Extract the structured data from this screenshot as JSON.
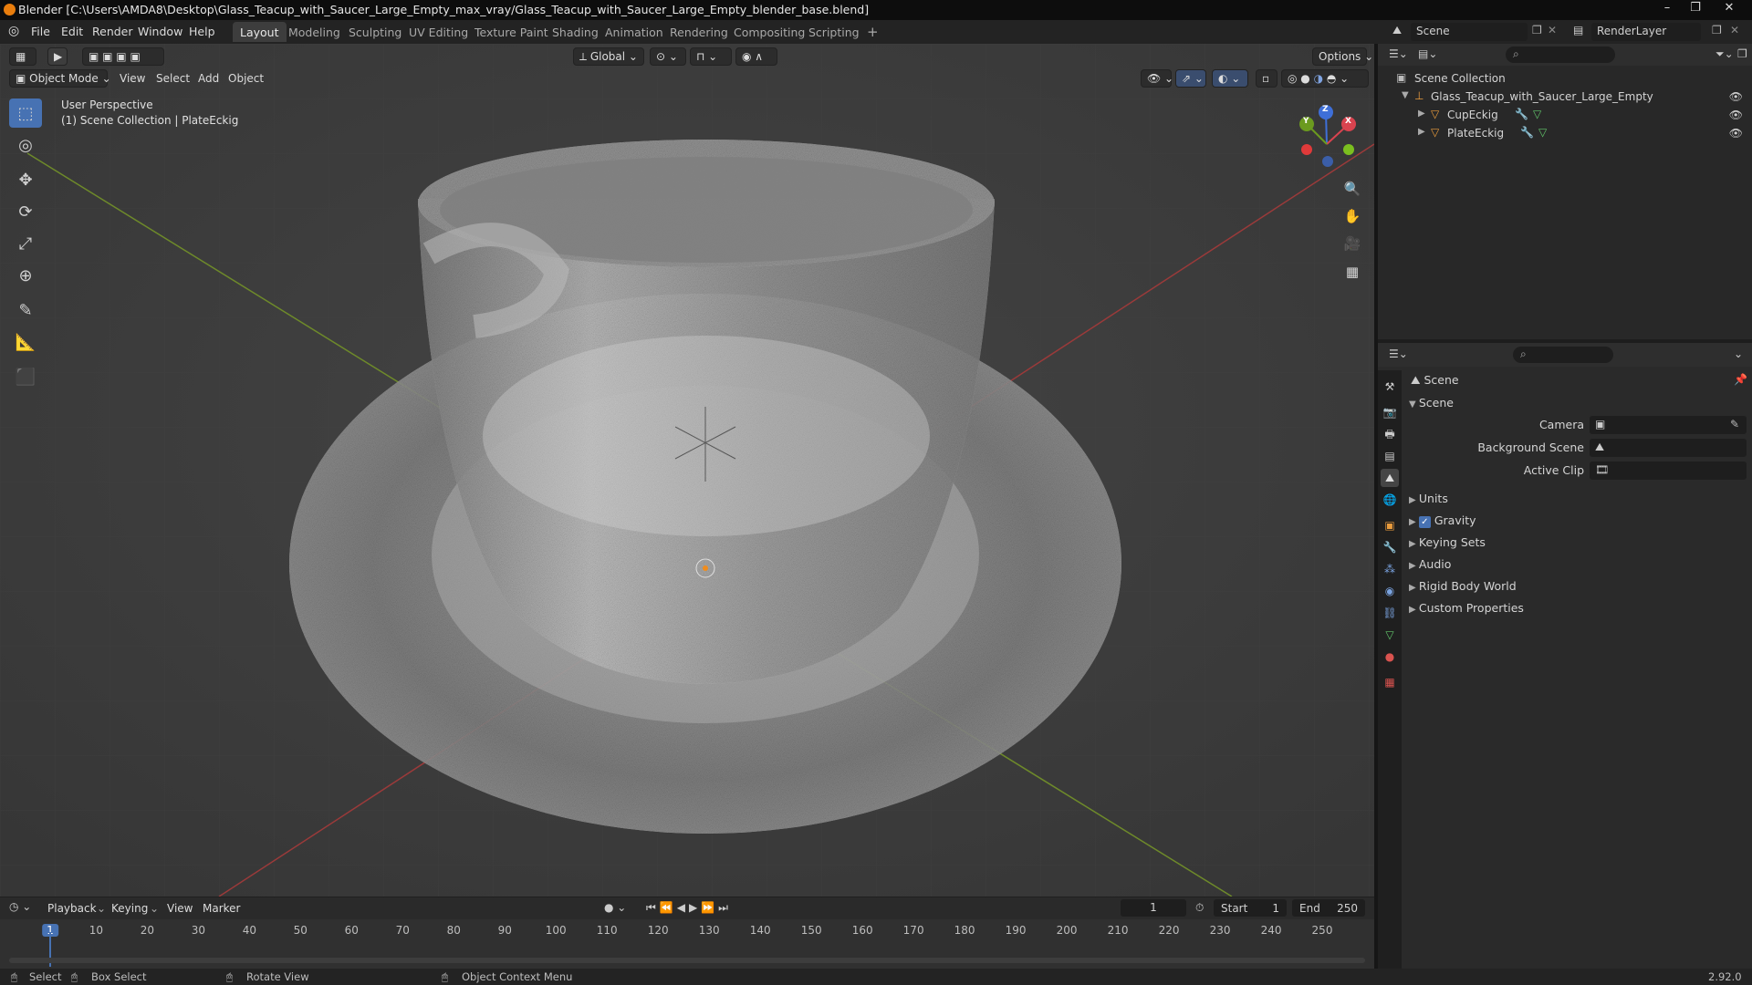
{
  "window": {
    "title": "Blender [C:\\Users\\AMDA8\\Desktop\\Glass_Teacup_with_Saucer_Large_Empty_max_vray/Glass_Teacup_with_Saucer_Large_Empty_blender_base.blend]"
  },
  "menu": [
    "File",
    "Edit",
    "Render",
    "Window",
    "Help"
  ],
  "workspaces": [
    "Layout",
    "Modeling",
    "Sculpting",
    "UV Editing",
    "Texture Paint",
    "Shading",
    "Animation",
    "Rendering",
    "Compositing",
    "Scripting"
  ],
  "active_workspace": "Layout",
  "scene_selector": "Scene",
  "render_layer": "RenderLayer",
  "viewport": {
    "mode": "Object Mode",
    "menus": [
      "View",
      "Select",
      "Add",
      "Object"
    ],
    "transform_orientation": "Global",
    "options": "Options",
    "overlay_title": "User Perspective",
    "overlay_sub": "(1) Scene Collection | PlateEckig",
    "gizmo": {
      "x": "X",
      "y": "Y",
      "z": "Z"
    }
  },
  "outliner": {
    "root": "Scene Collection",
    "items": [
      {
        "label": "Glass_Teacup_with_Saucer_Large_Empty",
        "level": 1
      },
      {
        "label": "CupEckig",
        "level": 2
      },
      {
        "label": "PlateEckig",
        "level": 2
      }
    ]
  },
  "properties": {
    "context": "Scene",
    "panel": "Scene",
    "fields": [
      {
        "label": "Camera"
      },
      {
        "label": "Background Scene"
      },
      {
        "label": "Active Clip"
      }
    ],
    "sections": [
      "Units",
      "Gravity",
      "Keying Sets",
      "Audio",
      "Rigid Body World",
      "Custom Properties"
    ],
    "gravity_checked": true
  },
  "timeline": {
    "menus": [
      "Playback",
      "Keying",
      "View",
      "Marker"
    ],
    "current_frame": "1",
    "start_label": "Start",
    "start": "1",
    "end_label": "End",
    "end": "250",
    "ticks": [
      "1",
      "10",
      "20",
      "30",
      "40",
      "50",
      "60",
      "70",
      "80",
      "90",
      "100",
      "110",
      "120",
      "130",
      "140",
      "150",
      "160",
      "170",
      "180",
      "190",
      "200",
      "210",
      "220",
      "230",
      "240",
      "250"
    ]
  },
  "status": {
    "select": "Select",
    "box_select": "Box Select",
    "rotate": "Rotate View",
    "context_menu": "Object Context Menu",
    "version": "2.92.0"
  }
}
